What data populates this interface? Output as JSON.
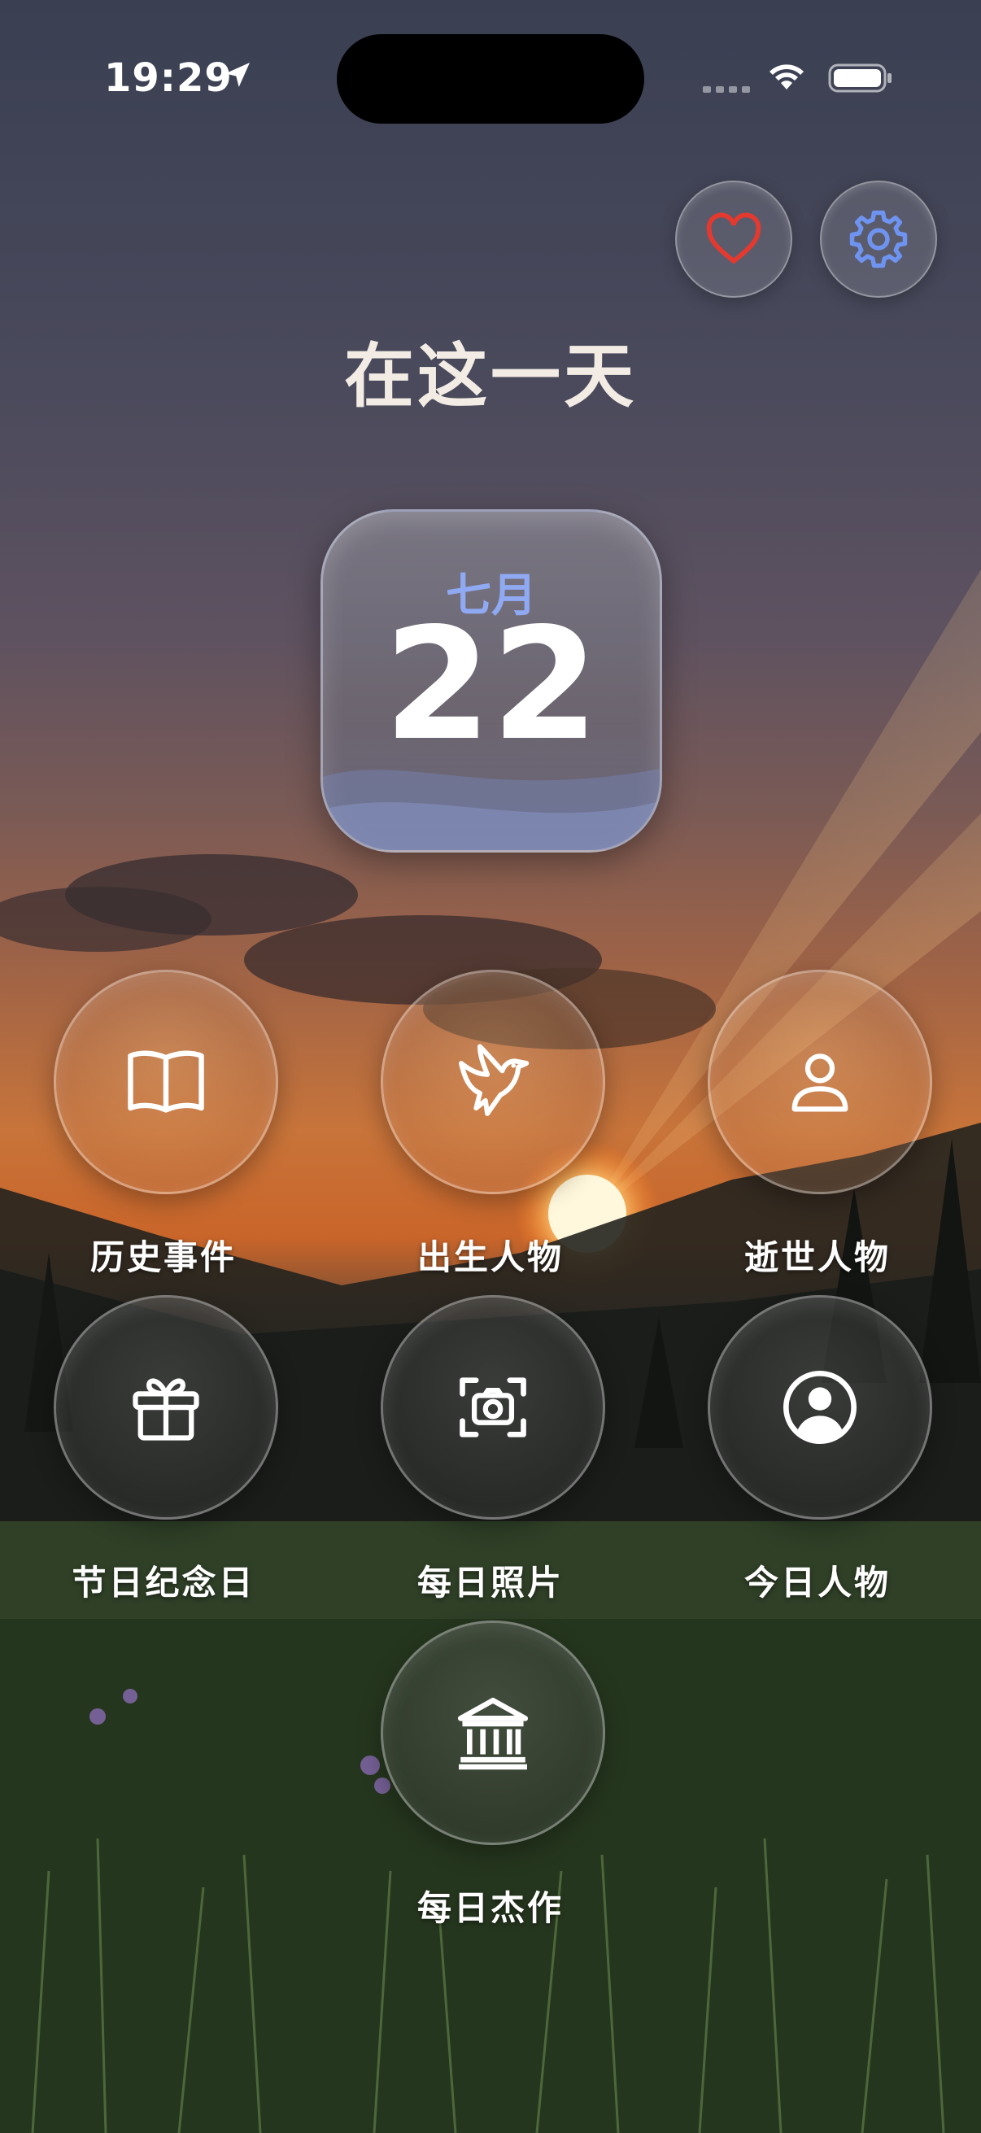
{
  "status_bar": {
    "time": "19:29"
  },
  "header": {
    "title": "在这一天"
  },
  "date_card": {
    "month": "七月",
    "day": "22"
  },
  "tiles": [
    {
      "label": "历史事件",
      "icon": "book-icon"
    },
    {
      "label": "出生人物",
      "icon": "bird-icon"
    },
    {
      "label": "逝世人物",
      "icon": "person-icon"
    },
    {
      "label": "节日纪念日",
      "icon": "gift-icon"
    },
    {
      "label": "每日照片",
      "icon": "camera-icon"
    },
    {
      "label": "今日人物",
      "icon": "person-circle-icon"
    },
    {
      "label": "每日杰作",
      "icon": "museum-icon"
    }
  ],
  "colors": {
    "heart": "#e5392f",
    "gear": "#6e93f0",
    "month": "#8fa9f3"
  }
}
